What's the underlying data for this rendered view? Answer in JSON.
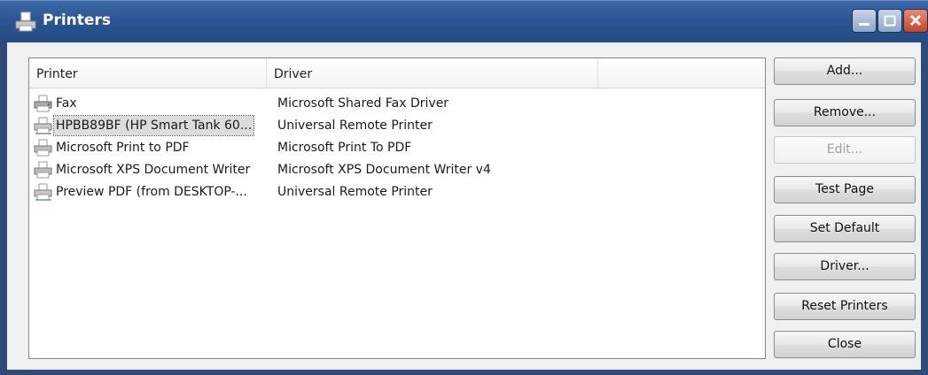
{
  "window": {
    "title": "Printers"
  },
  "listview": {
    "columns": [
      "Printer",
      "Driver",
      ""
    ],
    "rows": [
      {
        "printer": "Fax",
        "driver": "Microsoft Shared Fax Driver",
        "icon": "fax-printer-icon",
        "selected": false
      },
      {
        "printer": "HPBB89BF (HP Smart Tank 60...",
        "driver": "Universal Remote Printer",
        "icon": "network-printer-icon",
        "selected": true
      },
      {
        "printer": "Microsoft Print to PDF",
        "driver": "Microsoft Print To PDF",
        "icon": "printer-icon",
        "selected": false
      },
      {
        "printer": "Microsoft XPS Document Writer",
        "driver": "Microsoft XPS Document Writer v4",
        "icon": "printer-icon",
        "selected": false
      },
      {
        "printer": "Preview PDF (from DESKTOP-...",
        "driver": "Universal Remote Printer",
        "icon": "network-printer-icon",
        "selected": false
      }
    ]
  },
  "buttons": {
    "add": "Add...",
    "remove": "Remove...",
    "edit": "Edit...",
    "test_page": "Test Page",
    "set_default": "Set Default",
    "driver": "Driver...",
    "reset_printers": "Reset Printers",
    "close": "Close"
  },
  "colors": {
    "titlebar": "#2b5592",
    "client": "#f0f0f0",
    "selection": "#dcdcdc",
    "close_button": "#c4452a"
  }
}
